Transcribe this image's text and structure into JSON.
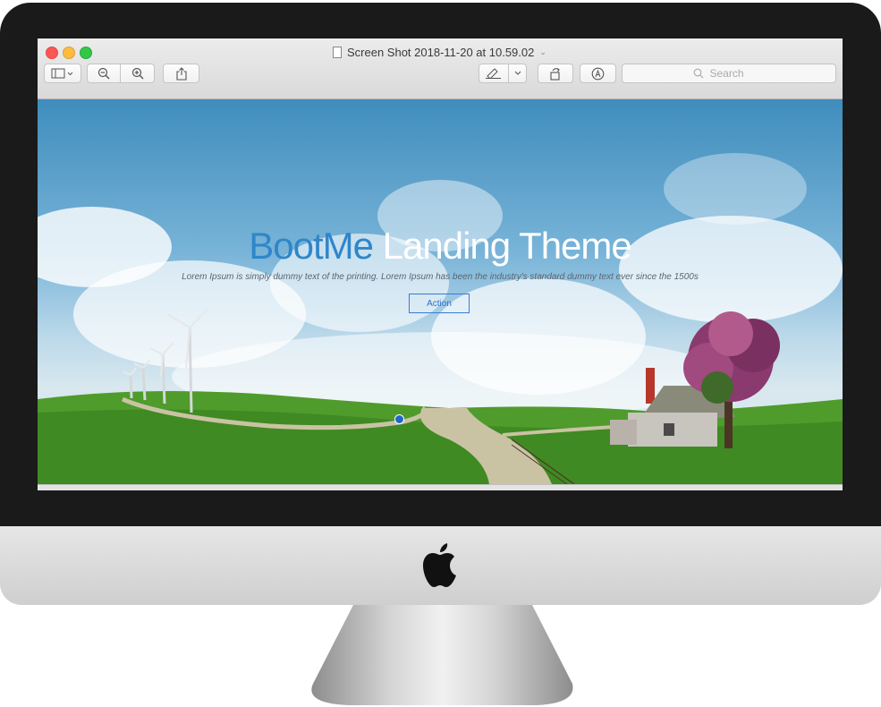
{
  "window": {
    "title": "Screen Shot 2018-11-20 at 10.59.02",
    "title_chevron": "⌄"
  },
  "toolbar": {
    "search_placeholder": "Search"
  },
  "landing": {
    "brand": "BootMe",
    "title_rest": " Landing Theme",
    "subtitle": "Lorem Ipsum is simply dummy text of the printing. Lorem Ipsum has been the industry's standard dummy text ever since the 1500s",
    "action_label": "Action"
  },
  "icons": [
    "sidebar-icon",
    "zoom-out-icon",
    "zoom-in-icon",
    "share-icon",
    "markup-pen-icon",
    "rotate-icon",
    "annotate-icon",
    "search-icon",
    "apple-logo-icon"
  ],
  "colors": {
    "brand_blue": "#2f86c9",
    "action_blue": "#3a7bd5",
    "close": "#fc5753",
    "minimize": "#fdbc40",
    "maximize": "#33c748"
  }
}
